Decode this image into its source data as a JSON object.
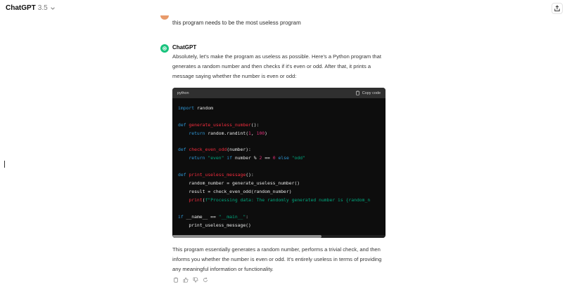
{
  "header": {
    "model_name": "ChatGPT",
    "model_version": "3.5"
  },
  "user_message": "this program needs to be the most useless program",
  "assistant": {
    "name": "ChatGPT",
    "intro": "Absolutely, let's make the program as useless as possible. Here's a Python program that generates a random number and then checks if it's even or odd. After that, it prints a message saying whether the number is even or odd:",
    "code_language": "python",
    "copy_label": "Copy code",
    "code_lines": [
      "import random",
      "",
      "def generate_useless_number():",
      "    return random.randint(1, 100)",
      "",
      "def check_even_odd(number):",
      "    return \"even\" if number % 2 == 0 else \"odd\"",
      "",
      "def print_useless_message():",
      "    random_number = generate_useless_number()",
      "    result = check_even_odd(random_number)",
      "    print(f\"Processing data: The randomly generated number is {random_n",
      "",
      "if __name__ == \"__main__\":",
      "    print_useless_message()"
    ],
    "outro": "This program essentially generates a random number, performs a trivial check, and then informs you whether the number is even or odd. It's entirely useless in terms of providing any meaningful information or functionality.",
    "code_scroll_fraction": 0.7
  },
  "icons": {
    "copy": "copy-icon",
    "thumbs_up": "thumbs-up-icon",
    "thumbs_down": "thumbs-down-icon",
    "regenerate": "regenerate-icon",
    "share": "share-icon",
    "chevron": "chevron-down-icon"
  },
  "colors": {
    "brand_green": "#19c37d",
    "code_bg": "#0d0d0d",
    "code_header": "#2f2f2f",
    "keyword": "#2e95d3",
    "function": "#f22c3d",
    "string": "#00a67d",
    "number": "#df3079"
  }
}
